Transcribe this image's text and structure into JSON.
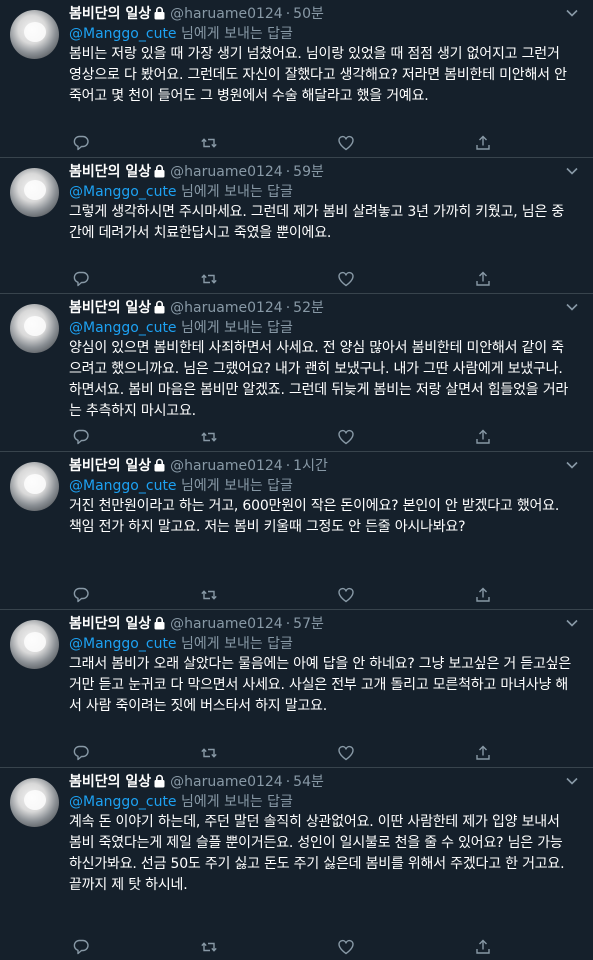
{
  "colors": {
    "background": "#15202b",
    "divider": "#38444d",
    "muted": "#8899a6",
    "link": "#1da1f2",
    "text": "#ffffff"
  },
  "icons": [
    "lock-icon",
    "chevron-down-icon",
    "reply-icon",
    "retweet-icon",
    "like-icon",
    "share-icon"
  ],
  "tweets": [
    {
      "name": "봄비단의 일상",
      "handle": "@haruame0124",
      "dot": "·",
      "time": "50분",
      "mention": "@Manggo_cute",
      "reply_suffix": "님에게 보내는 답글",
      "text": "봄비는 저랑 있을 때 가장 생기 넘쳤어요. 님이랑 있었을 때 점점 생기 없어지고 그런거 영상으로 다 봤어요. 그런데도 자신이 잘했다고 생각해요? 저라면 봄비한테 미안해서 안 죽어고 몇 천이 들어도 그 병원에서 수술 해달라고 했을 거예요."
    },
    {
      "name": "봄비단의 일상",
      "handle": "@haruame0124",
      "dot": "·",
      "time": "59분",
      "mention": "@Manggo_cute",
      "reply_suffix": "님에게 보내는 답글",
      "text": "그렇게 생각하시면 주시마세요. 그런데 제가 봄비 살려놓고 3년 가까히 키웠고, 님은 중간에 데려가서 치료한답시고 죽였을 뿐이에요."
    },
    {
      "name": "봄비단의 일상",
      "handle": "@haruame0124",
      "dot": "·",
      "time": "52분",
      "mention": "@Manggo_cute",
      "reply_suffix": "님에게 보내는 답글",
      "text": "양심이 있으면 봄비한테 사죄하면서 사세요. 전 양심 많아서 봄비한테 미안해서 같이 죽으려고 했으니까요. 님은 그랬어요? 내가 괜히 보냈구나. 내가 그딴 사람에게 보냈구나. 하면서요. 봄비 마음은 봄비만 알겠죠. 그런데 뒤늦게 봄비는 저랑 살면서 힘들었을 거라는 추측하지 마시고요."
    },
    {
      "name": "봄비단의 일상",
      "handle": "@haruame0124",
      "dot": "·",
      "time": "1시간",
      "mention": "@Manggo_cute",
      "reply_suffix": "님에게 보내는 답글",
      "text": "거진 천만원이라고 하는 거고, 600만원이 작은 돈이에요? 본인이 안 받겠다고 했어요. 책임 전가 하지 말고요. 저는 봄비 키울때 그정도 안 든줄 아시나봐요?"
    },
    {
      "name": "봄비단의 일상",
      "handle": "@haruame0124",
      "dot": "·",
      "time": "57분",
      "mention": "@Manggo_cute",
      "reply_suffix": "님에게 보내는 답글",
      "text": "그래서 봄비가 오래 살았다는 물음에는 아예 답을 안 하네요? 그냥 보고싶은 거 듣고싶은 거만 듣고 눈귀코 다 막으면서 사세요. 사실은 전부 고개 돌리고 모른척하고 마녀사냥 해서 사람 죽이려는 짓에 버스타서 하지 말고요."
    },
    {
      "name": "봄비단의 일상",
      "handle": "@haruame0124",
      "dot": "·",
      "time": "54분",
      "mention": "@Manggo_cute",
      "reply_suffix": "님에게 보내는 답글",
      "text": "계속 돈 이야기 하는데, 주던 말던 솔직히 상관없어요. 이딴 사람한테 제가 입양 보내서 봄비 죽였다는게 제일 슬플 뿐이거든요. 성인이 일시불로 천을 줄 수 있어요? 님은 가능하신가봐요. 선금 50도 주기 싫고 돈도 주기 싫은데 봄비를 위해서 주겠다고 한 거고요.끝까지 제 탓 하시네."
    }
  ]
}
